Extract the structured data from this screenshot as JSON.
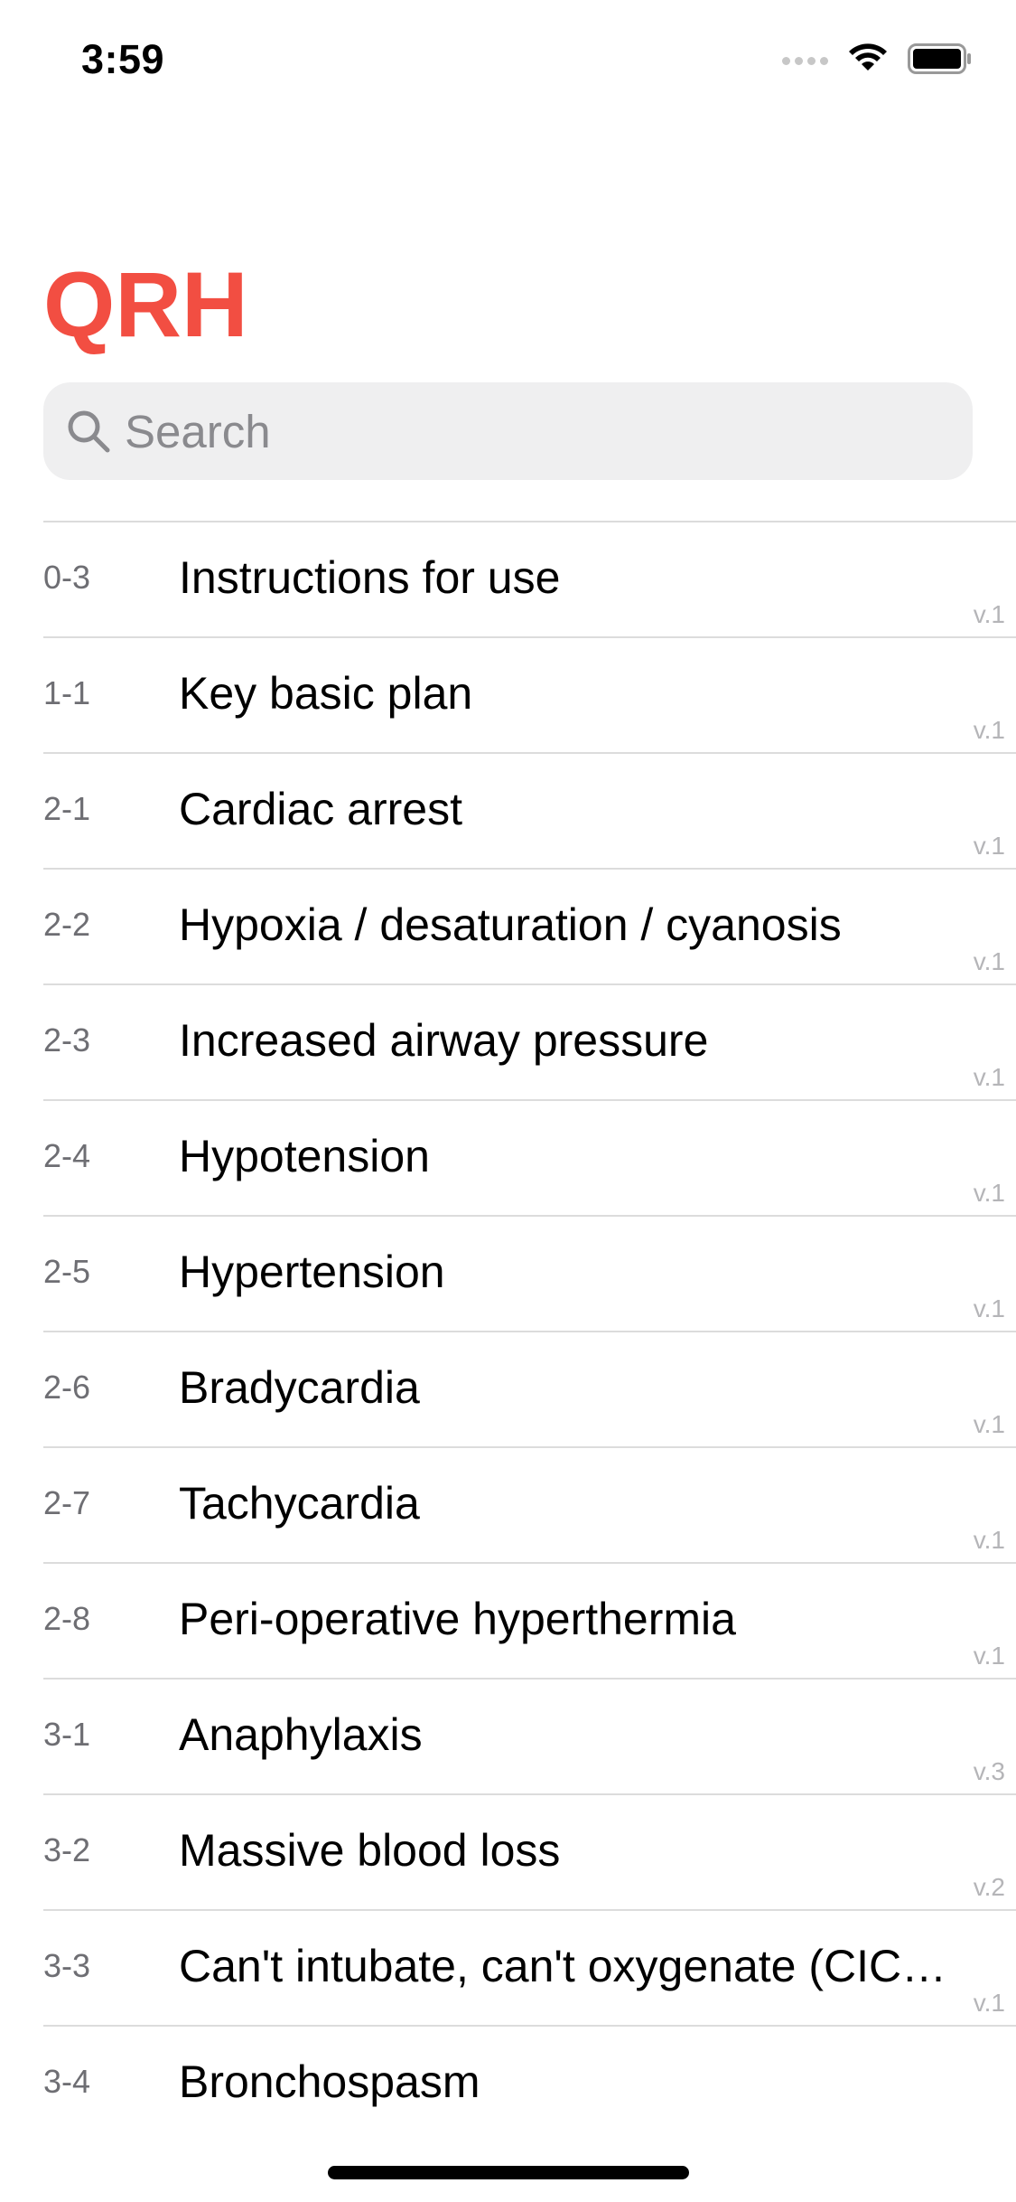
{
  "status_bar": {
    "time": "3:59"
  },
  "header": {
    "title": "QRH",
    "accent_color": "#f24e42"
  },
  "search": {
    "placeholder": "Search",
    "value": ""
  },
  "list": {
    "items": [
      {
        "code": "0-3",
        "title": "Instructions for use",
        "version": "v.1"
      },
      {
        "code": "1-1",
        "title": "Key basic plan",
        "version": "v.1"
      },
      {
        "code": "2-1",
        "title": "Cardiac arrest",
        "version": "v.1"
      },
      {
        "code": "2-2",
        "title": "Hypoxia / desaturation / cyanosis",
        "version": "v.1"
      },
      {
        "code": "2-3",
        "title": "Increased airway pressure",
        "version": "v.1"
      },
      {
        "code": "2-4",
        "title": "Hypotension",
        "version": "v.1"
      },
      {
        "code": "2-5",
        "title": "Hypertension",
        "version": "v.1"
      },
      {
        "code": "2-6",
        "title": "Bradycardia",
        "version": "v.1"
      },
      {
        "code": "2-7",
        "title": "Tachycardia",
        "version": "v.1"
      },
      {
        "code": "2-8",
        "title": "Peri-operative hyperthermia",
        "version": "v.1"
      },
      {
        "code": "3-1",
        "title": "Anaphylaxis",
        "version": "v.3"
      },
      {
        "code": "3-2",
        "title": "Massive blood loss",
        "version": "v.2"
      },
      {
        "code": "3-3",
        "title": "Can't intubate, can't oxygenate (CIC…",
        "version": "v.1"
      },
      {
        "code": "3-4",
        "title": "Bronchospasm",
        "version": ""
      }
    ]
  },
  "icons": {
    "search": "search-icon",
    "wifi": "wifi-icon",
    "battery": "battery-icon",
    "signal": "cellular-signal-icon"
  }
}
